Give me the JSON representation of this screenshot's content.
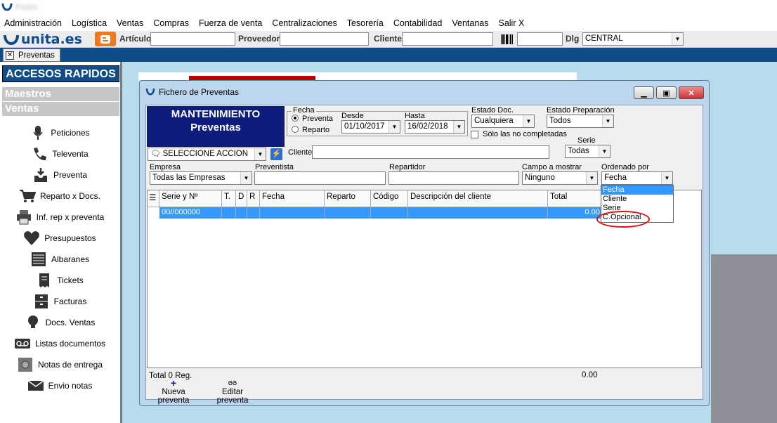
{
  "app": {
    "title_blurred": "Pedro"
  },
  "menu": [
    "Administración",
    "Logística",
    "Ventas",
    "Compras",
    "Fuerza de venta",
    "Centralizaciones",
    "Tesorería",
    "Contabilidad",
    "Ventanas",
    "Salir X"
  ],
  "toolbar": {
    "logo": "unita.es",
    "articulo_label": "Artículo",
    "proveedor_label": "Proveedor",
    "cliente_label": "Cliente",
    "dlg_label": "Dlg",
    "dlg_value": "CENTRAL"
  },
  "tabs": [
    {
      "label": "Preventas"
    }
  ],
  "sidebar": {
    "title": "ACCESOS RAPIDOS",
    "sections": [
      "Maestros",
      "Ventas"
    ],
    "items": [
      {
        "label": "Peticiones",
        "icon": "microphone-icon"
      },
      {
        "label": "Televenta",
        "icon": "phone-icon"
      },
      {
        "label": "Preventa",
        "icon": "inbox-download-icon"
      },
      {
        "label": "Reparto x Docs.",
        "icon": "cart-icon"
      },
      {
        "label": "Inf. rep x preventa",
        "icon": "printer-icon"
      },
      {
        "label": "Presupuestos",
        "icon": "heart-icon"
      },
      {
        "label": "Albaranes",
        "icon": "list-icon"
      },
      {
        "label": "Tickets",
        "icon": "receipt-icon"
      },
      {
        "label": "Facturas",
        "icon": "file-cabinet-icon"
      },
      {
        "label": "Docs. Ventas",
        "icon": "lightbulb-icon"
      },
      {
        "label": "Listas documentos",
        "icon": "voicemail-icon"
      },
      {
        "label": "Notas de entrega",
        "icon": "safe-icon"
      },
      {
        "label": "Envio notas",
        "icon": "envelope-icon"
      }
    ]
  },
  "window": {
    "title": "Fichero de Preventas",
    "header_line1": "MANTENIMIENTO",
    "header_line2": "Preventas",
    "fecha": {
      "label": "Fecha",
      "radio_preventa": "Preventa",
      "radio_reparto": "Reparto",
      "desde_label": "Desde",
      "desde_value": "01/10/2017",
      "hasta_label": "Hasta",
      "hasta_value": "16/02/2018"
    },
    "estado_doc": {
      "label": "Estado Doc.",
      "value": "Cualquiera"
    },
    "estado_prep": {
      "label": "Estado Preparación",
      "value": "Todos"
    },
    "solo_no_completadas": "Sólo las no completadas",
    "serie": {
      "label": "Serie",
      "value": "Todas"
    },
    "accion_value": "SELECCIONE ACCION",
    "cliente_label": "Cliente",
    "empresa": {
      "label": "Empresa",
      "value": "Todas las Empresas"
    },
    "preventista_label": "Preventista",
    "repartidor_label": "Repartidor",
    "campo_mostrar": {
      "label": "Campo a mostrar",
      "value": "Ninguno"
    },
    "ordenado_por": {
      "label": "Ordenado por",
      "value": "Fecha",
      "options": [
        "Fecha",
        "Cliente",
        "Serie",
        "C.Opcional"
      ]
    },
    "grid": {
      "columns": [
        "Serie y Nº",
        "T.",
        "D",
        "R",
        "Fecha",
        "Reparto",
        "Código",
        "Descripción del cliente",
        "Total"
      ],
      "rows": [
        {
          "serie": "00//000000",
          "total": "0.00 €"
        }
      ]
    },
    "status": {
      "total_reg": "Total 0 Reg.",
      "sum": "0.00"
    },
    "actions": {
      "nueva": "Nueva preventa",
      "editar": "Editar preventa"
    }
  }
}
